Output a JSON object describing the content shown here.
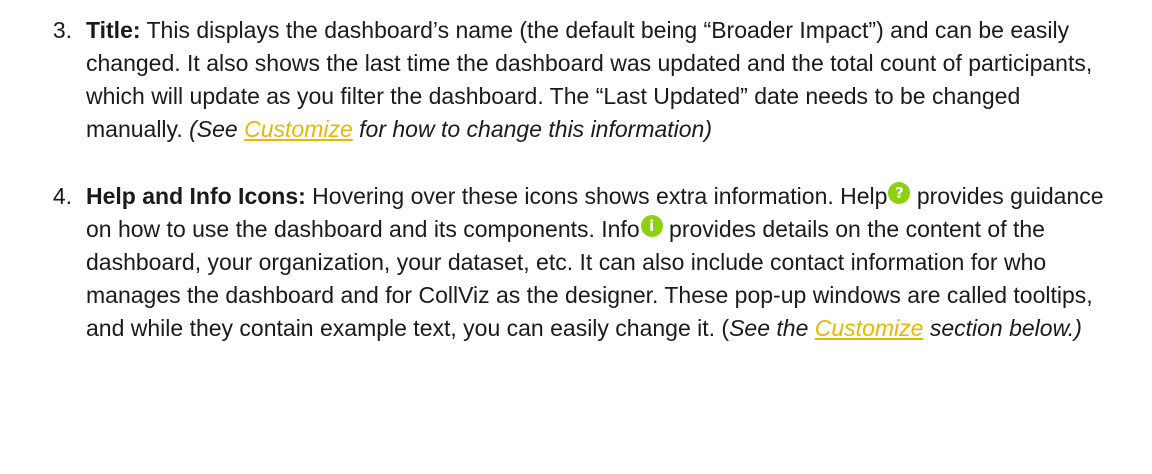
{
  "items": [
    {
      "number": "3.",
      "term": "Title:",
      "text1": " This displays the dashboard’s name (the default being “Broader Impact”) and can be easily changed. It also shows the last time the dashboard was updated and the total count of participants, which will update as you filter the dashboard. The “Last Updated” date needs to be changed manually.  ",
      "aside_pre": "(See ",
      "link": "Customize",
      "aside_post": " for how to change this information)"
    },
    {
      "number": "4.",
      "term": "Help and Info Icons:",
      "text1": " Hovering over these icons shows extra information. Help",
      "help_glyph": "?",
      "text2": " provides guidance on how to use the dashboard and its components. Info",
      "info_glyph": "i",
      "text3": " provides details on the content of the dashboard, your organization, your dataset, etc. It can also include contact information for who manages the dashboard and for CollViz as the designer. These pop-up windows are called tooltips, and while they contain example text, you can easily change it. (",
      "aside_pre": "See the ",
      "link": "Customize",
      "aside_post": " section below.)",
      "closing": ""
    }
  ],
  "icons": {
    "help": "help-icon",
    "info": "info-icon",
    "badge_color": "#8bd10f"
  },
  "colors": {
    "link": "#e6b800",
    "text": "#1a1a1a"
  }
}
